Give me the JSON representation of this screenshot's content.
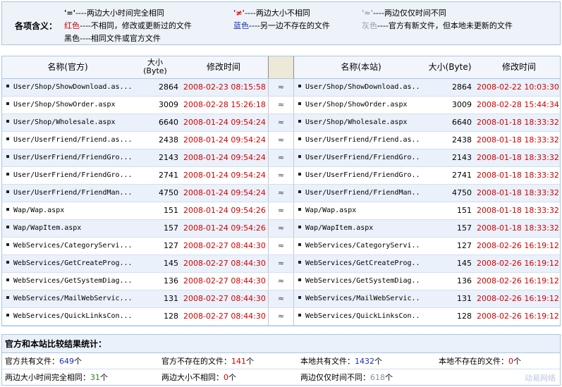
{
  "legend": {
    "lead": "各项含义：",
    "items": [
      {
        "sym": "'='",
        "text": "----两边大小时间完全相同"
      },
      {
        "sym": "'≠'",
        "text": "----两边大小不相同"
      },
      {
        "sym": "'≈'",
        "text": "----两边仅仅时间不同"
      },
      {
        "sym": "红色",
        "text": "----不相同，修改或更新过的文件"
      },
      {
        "sym": "蓝色",
        "text": "----另一边不存在的文件"
      },
      {
        "sym": "灰色",
        "text": "----官方有新文件，但本地未更新的文件"
      },
      {
        "sym": "黑色",
        "text": "----相同文件或官方文件"
      }
    ]
  },
  "table": {
    "headers": {
      "name_official": "名称(官方)",
      "size_line1": "大小",
      "size_line2": "(Byte)",
      "time": "修改时间",
      "name_local": "名称(本站)",
      "size_local": "大小(Byte)",
      "time_local": "修改时间"
    },
    "rows": [
      {
        "name": "User/Shop/ShowDownload.as...",
        "size": "2864",
        "time": "2008-02-23 08:15:58",
        "cmp": "≈",
        "name_r": "User/Shop/ShowDownload.as...",
        "size_r": "2864",
        "time_r": "2008-02-22 10:03:30"
      },
      {
        "name": "User/Shop/ShowOrder.aspx",
        "size": "3009",
        "time": "2008-02-28 15:26:18",
        "cmp": "≈",
        "name_r": "User/Shop/ShowOrder.aspx",
        "size_r": "3009",
        "time_r": "2008-02-28 15:44:34"
      },
      {
        "name": "User/Shop/Wholesale.aspx",
        "size": "6640",
        "time": "2008-01-24 09:54:24",
        "cmp": "≈",
        "name_r": "User/Shop/Wholesale.aspx",
        "size_r": "6640",
        "time_r": "2008-01-18 18:33:32"
      },
      {
        "name": "User/UserFriend/Friend.as...",
        "size": "2438",
        "time": "2008-01-24 09:54:24",
        "cmp": "≈",
        "name_r": "User/UserFriend/Friend.as...",
        "size_r": "2438",
        "time_r": "2008-01-18 18:33:32"
      },
      {
        "name": "User/UserFriend/FriendGro...",
        "size": "2143",
        "time": "2008-01-24 09:54:24",
        "cmp": "≈",
        "name_r": "User/UserFriend/FriendGro...",
        "size_r": "2143",
        "time_r": "2008-01-18 18:33:32"
      },
      {
        "name": "User/UserFriend/FriendGro...",
        "size": "2741",
        "time": "2008-01-24 09:54:24",
        "cmp": "≈",
        "name_r": "User/UserFriend/FriendGro...",
        "size_r": "2741",
        "time_r": "2008-01-18 18:33:32"
      },
      {
        "name": "User/UserFriend/FriendMan...",
        "size": "4750",
        "time": "2008-01-24 09:54:24",
        "cmp": "≈",
        "name_r": "User/UserFriend/FriendMan...",
        "size_r": "4750",
        "time_r": "2008-01-18 18:33:32"
      },
      {
        "name": "Wap/Wap.aspx",
        "size": "151",
        "time": "2008-01-24 09:54:26",
        "cmp": "≈",
        "name_r": "Wap/Wap.aspx",
        "size_r": "151",
        "time_r": "2008-01-18 18:33:32"
      },
      {
        "name": "Wap/WapItem.aspx",
        "size": "157",
        "time": "2008-01-24 09:54:26",
        "cmp": "≈",
        "name_r": "Wap/WapItem.aspx",
        "size_r": "157",
        "time_r": "2008-01-18 18:33:32"
      },
      {
        "name": "WebServices/CategoryServi...",
        "size": "127",
        "time": "2008-02-27 08:44:30",
        "cmp": "≈",
        "name_r": "WebServices/CategoryServi...",
        "size_r": "127",
        "time_r": "2008-02-26 16:19:12"
      },
      {
        "name": "WebServices/GetCreateProg...",
        "size": "145",
        "time": "2008-02-27 08:44:30",
        "cmp": "≈",
        "name_r": "WebServices/GetCreateProg...",
        "size_r": "145",
        "time_r": "2008-02-26 16:19:12"
      },
      {
        "name": "WebServices/GetSystemDiag...",
        "size": "136",
        "time": "2008-02-27 08:44:30",
        "cmp": "≈",
        "name_r": "WebServices/GetSystemDiag...",
        "size_r": "136",
        "time_r": "2008-02-26 16:19:12"
      },
      {
        "name": "WebServices/MailWebServic...",
        "size": "131",
        "time": "2008-02-27 08:44:30",
        "cmp": "≈",
        "name_r": "WebServices/MailWebServic...",
        "size_r": "131",
        "time_r": "2008-02-26 16:19:12"
      },
      {
        "name": "WebServices/QuickLinksCon...",
        "size": "128",
        "time": "2008-02-27 08:44:30",
        "cmp": "≈",
        "name_r": "WebServices/QuickLinksCon...",
        "size_r": "128",
        "time_r": "2008-02-26 16:19:12"
      }
    ]
  },
  "stats": {
    "title": "官方和本站比较结果统计：",
    "items": [
      {
        "label": "官方共有文件：",
        "value": "649",
        "unit": "个",
        "color": "blue"
      },
      {
        "label": "官方不存在的文件：",
        "value": "141",
        "unit": "个",
        "color": "red"
      },
      {
        "label": "本地共有文件：",
        "value": "1432",
        "unit": "个",
        "color": "blue"
      },
      {
        "label": "本地不存在的文件：",
        "value": "0",
        "unit": "个",
        "color": "red"
      },
      {
        "label": "两边大小时间完全相同：",
        "value": "31",
        "unit": "个",
        "color": "green"
      },
      {
        "label": "两边大小不相同：",
        "value": "0",
        "unit": "个",
        "color": "red"
      },
      {
        "label": "两边仅仅时间不同：",
        "value": "618",
        "unit": "个",
        "color": "gray"
      }
    ],
    "watermark": "动易网络"
  }
}
